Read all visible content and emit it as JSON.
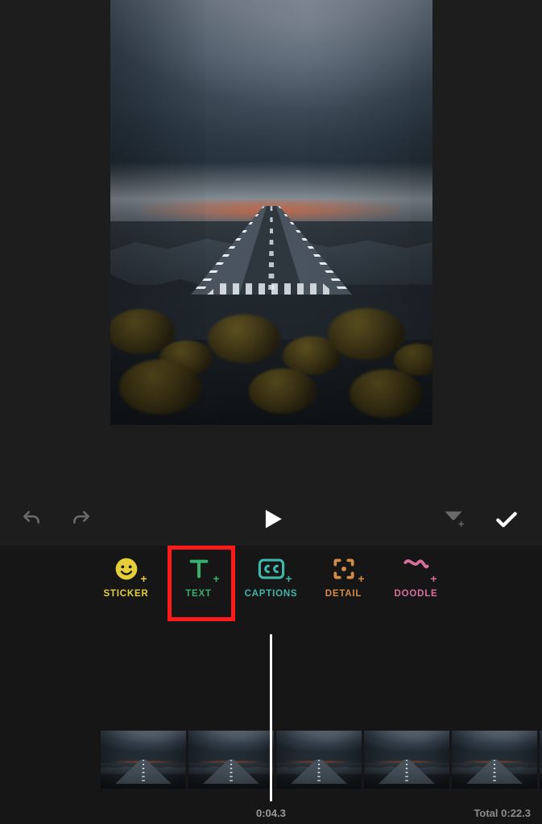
{
  "tools": {
    "sticker": {
      "label": "STICKER",
      "icon": "smiley-plus-icon"
    },
    "text": {
      "label": "TEXT",
      "icon": "text-plus-icon"
    },
    "captions": {
      "label": "CAPTIONS",
      "icon": "cc-plus-icon"
    },
    "detail": {
      "label": "DETAIL",
      "icon": "focus-plus-icon"
    },
    "doodle": {
      "label": "DOODLE",
      "icon": "squiggle-plus-icon"
    }
  },
  "highlighted_tool": "text",
  "controls": {
    "undo": "undo-icon",
    "redo": "redo-icon",
    "play": "play-icon",
    "filter": "funnel-plus-icon",
    "done": "check-icon"
  },
  "timeline": {
    "current": "0:04.3",
    "total_label": "Total 0:22.3"
  },
  "colors": {
    "sticker": "#e4cf3a",
    "text": "#35b06e",
    "captions": "#3fb6a9",
    "detail": "#d58a45",
    "doodle": "#d86f9b",
    "highlight": "#ff1a1a"
  }
}
